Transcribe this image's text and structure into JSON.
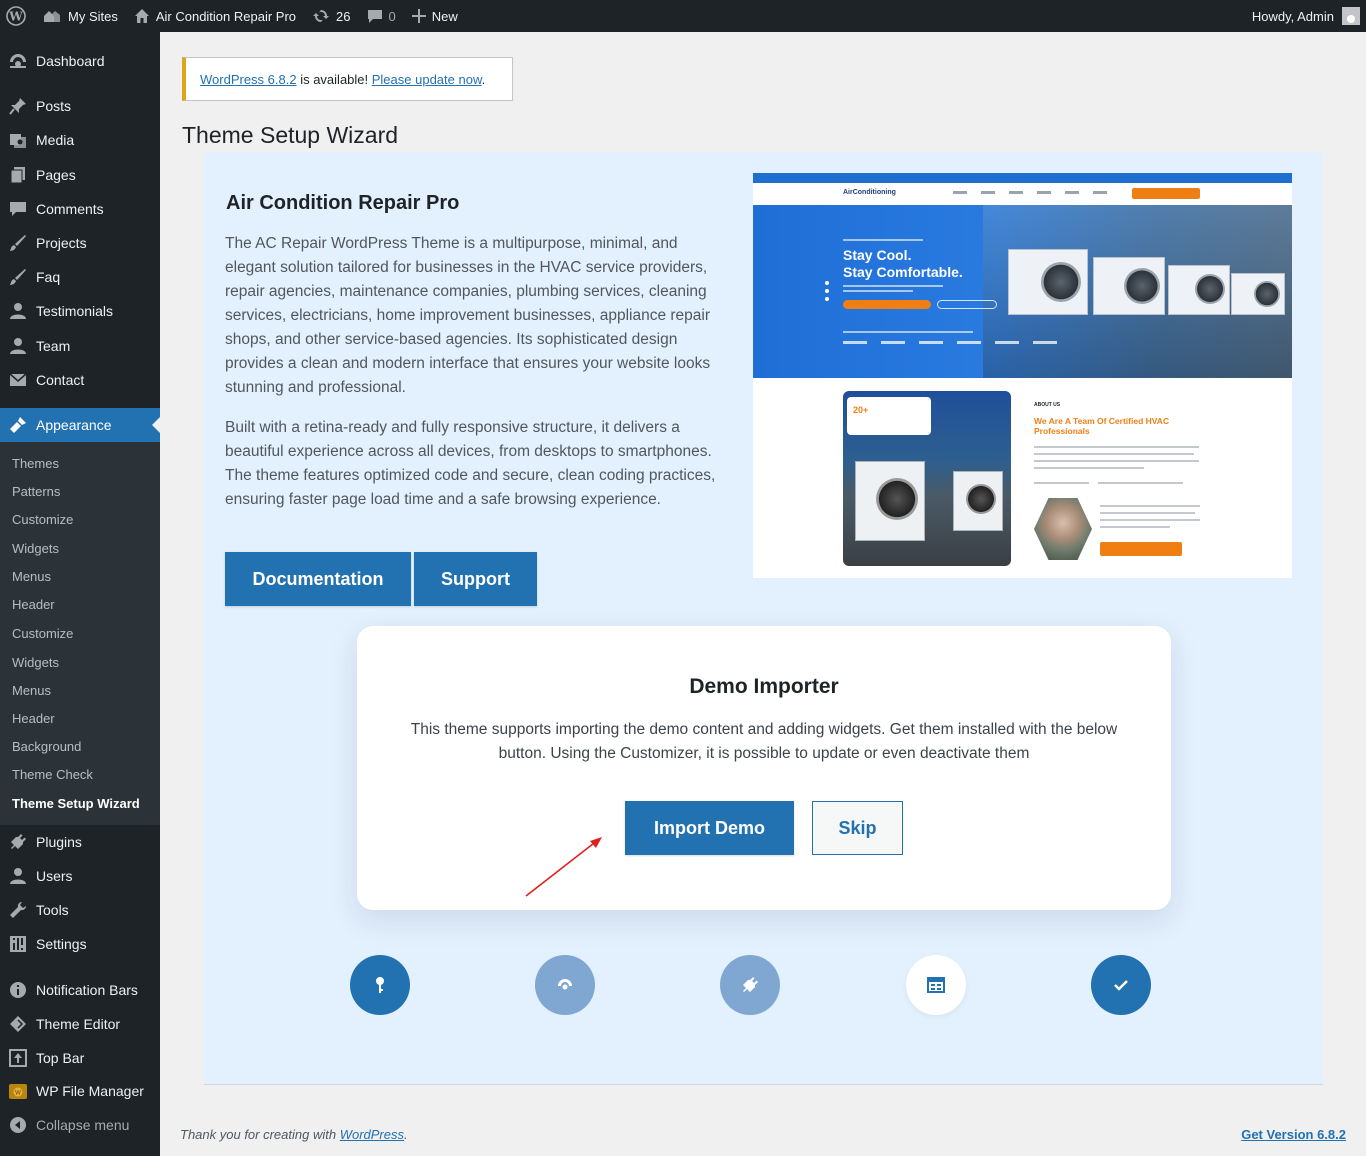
{
  "admin_bar": {
    "my_sites": "My Sites",
    "site_name": "Air Condition Repair Pro",
    "updates_count": "26",
    "comments_count": "0",
    "new_label": "New",
    "howdy": "Howdy, Admin"
  },
  "sidebar": {
    "items": [
      {
        "label": "Dashboard",
        "icon": "dashboard-icon"
      },
      {
        "label": "Posts",
        "icon": "pin-icon"
      },
      {
        "label": "Media",
        "icon": "media-icon"
      },
      {
        "label": "Pages",
        "icon": "pages-icon"
      },
      {
        "label": "Comments",
        "icon": "comment-icon"
      },
      {
        "label": "Projects",
        "icon": "brush-icon"
      },
      {
        "label": "Faq",
        "icon": "brush-icon"
      },
      {
        "label": "Testimonials",
        "icon": "user-icon"
      },
      {
        "label": "Team",
        "icon": "user-icon"
      },
      {
        "label": "Contact",
        "icon": "envelope-icon"
      },
      {
        "label": "Appearance",
        "icon": "appearance-icon"
      },
      {
        "label": "Plugins",
        "icon": "plugin-icon"
      },
      {
        "label": "Users",
        "icon": "user-icon"
      },
      {
        "label": "Tools",
        "icon": "wrench-icon"
      },
      {
        "label": "Settings",
        "icon": "settings-icon"
      },
      {
        "label": "Notification Bars",
        "icon": "info-icon"
      },
      {
        "label": "Theme Editor",
        "icon": "diamond-icon"
      },
      {
        "label": "Top Bar",
        "icon": "upload-icon"
      },
      {
        "label": "WP File Manager",
        "icon": "file-manager-icon"
      },
      {
        "label": "Collapse menu",
        "icon": "collapse-icon"
      }
    ],
    "submenu": [
      "Themes",
      "Patterns",
      "Customize",
      "Widgets",
      "Menus",
      "Header",
      "Customize",
      "Widgets",
      "Menus",
      "Header",
      "Background",
      "Theme Check",
      "Theme Setup Wizard"
    ]
  },
  "notice": {
    "version_link": "WordPress 6.8.2",
    "middle": " is available! ",
    "update_link": "Please update now",
    "end": "."
  },
  "page_title": "Theme Setup Wizard",
  "theme": {
    "name": "Air Condition Repair Pro",
    "desc1": "The AC Repair WordPress Theme is a multipurpose, minimal, and elegant solution tailored for businesses in the HVAC service providers, repair agencies, maintenance companies, plumbing services, cleaning services, electricians, home improvement businesses, appliance repair shops, and other service-based agencies. Its sophisticated design provides a clean and modern interface that ensures your website looks stunning and professional.",
    "desc2": "Built with a retina-ready and fully responsive structure, it delivers a beautiful experience across all devices, from desktops to smartphones. The theme features optimized code and secure, clean coding practices, ensuring faster page load time and a safe browsing experience.",
    "doc_button": "Documentation",
    "support_button": "Support"
  },
  "preview": {
    "logo": "AirConditioning",
    "hero_line1": "Stay Cool.",
    "hero_line2": "Stay Comfortable.",
    "badge": "20+",
    "about_label": "ABOUT US",
    "about_heading": "We Are A Team Of Certified HVAC Professionals"
  },
  "demo": {
    "title": "Demo Importer",
    "description": "This theme supports importing the demo content and adding widgets. Get them installed with the below button. Using the Customizer, it is possible to update or even deactivate them",
    "import_button": "Import Demo",
    "skip_button": "Skip"
  },
  "steps": [
    {
      "icon": "key-icon",
      "state": "done"
    },
    {
      "icon": "dashboard-icon",
      "state": "pending"
    },
    {
      "icon": "plugin-icon",
      "state": "pending"
    },
    {
      "icon": "widgets-icon",
      "state": "active"
    },
    {
      "icon": "check-icon",
      "state": "done"
    }
  ],
  "footer": {
    "thanks": "Thank you for creating with ",
    "wp_link": "WordPress",
    "period": ".",
    "version": "Get Version 6.8.2"
  },
  "colors": {
    "accent": "#2271b1",
    "admin_bg": "#1d2327",
    "panel_bg": "#e3f0fd",
    "preview_orange": "#f07f13"
  }
}
